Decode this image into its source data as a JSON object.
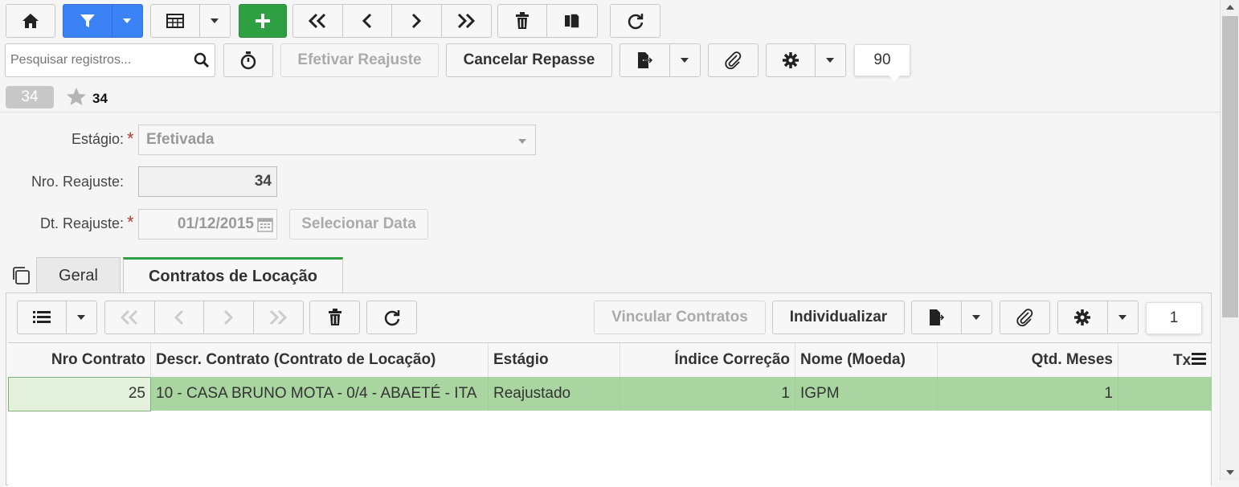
{
  "toolbar": {
    "search_placeholder": "Pesquisar registros...",
    "efetivar_label": "Efetivar Reajuste",
    "cancelar_label": "Cancelar Repasse",
    "page_size": "90"
  },
  "record": {
    "badge": "34",
    "title": "34"
  },
  "form": {
    "estagio_label": "Estágio:",
    "estagio_value": "Efetivada",
    "nro_label": "Nro. Reajuste:",
    "nro_value": "34",
    "dt_label": "Dt. Reajuste:",
    "dt_value": "01/12/2015",
    "select_date_label": "Selecionar Data"
  },
  "tabs": [
    {
      "label": "Geral"
    },
    {
      "label": "Contratos de Locação"
    }
  ],
  "subtoolbar": {
    "vincular_label": "Vincular Contratos",
    "individualizar_label": "Individualizar",
    "page_size": "1"
  },
  "grid": {
    "headers": [
      "Nro Contrato",
      "Descr. Contrato (Contrato de Locação)",
      "Estágio",
      "Índice Correção",
      "Nome (Moeda)",
      "Qtd. Meses",
      "Tx"
    ],
    "rows": [
      [
        "25",
        "10 - CASA BRUNO MOTA - 0/4 - ABAETÉ - ITA",
        "Reajustado",
        "1",
        "IGPM",
        "1",
        ""
      ]
    ]
  },
  "colors": {
    "accent_blue": "#3b82f6",
    "accent_green": "#2ea043",
    "row_selected": "#a8d5a0"
  }
}
